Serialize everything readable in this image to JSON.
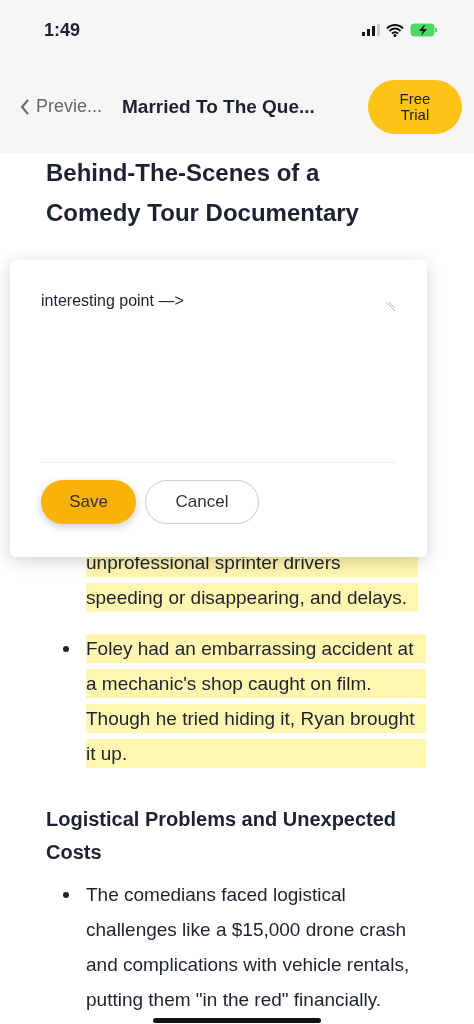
{
  "status_bar": {
    "time": "1:49"
  },
  "nav": {
    "back_label": "Previe...",
    "title": "Married To The Que...",
    "cta": "Free Trial"
  },
  "article": {
    "title": "Behind-The-Scenes of a Comedy Tour Documentary",
    "items": [
      {
        "kind": "continuation",
        "text": "unprofessional sprinter drivers speeding or disappearing, and delays.",
        "highlighted": true
      },
      {
        "kind": "bullet",
        "text": "Foley had an embarrassing accident at a mechanic's shop caught on film. Though he tried hiding it, Ryan brought it up.",
        "highlighted": true
      },
      {
        "kind": "heading",
        "text": "Logistical Problems and Unexpected Costs"
      },
      {
        "kind": "bullet",
        "text": "The comedians faced logistical challenges like a $15,000 drone crash and complications with vehicle rentals, putting them \"in the red\" financially.",
        "highlighted": false
      }
    ]
  },
  "note_dialog": {
    "value": "interesting point —>",
    "buttons": [
      {
        "label": "Save",
        "kind": "primary"
      },
      {
        "label": "Cancel",
        "kind": "secondary"
      }
    ]
  }
}
